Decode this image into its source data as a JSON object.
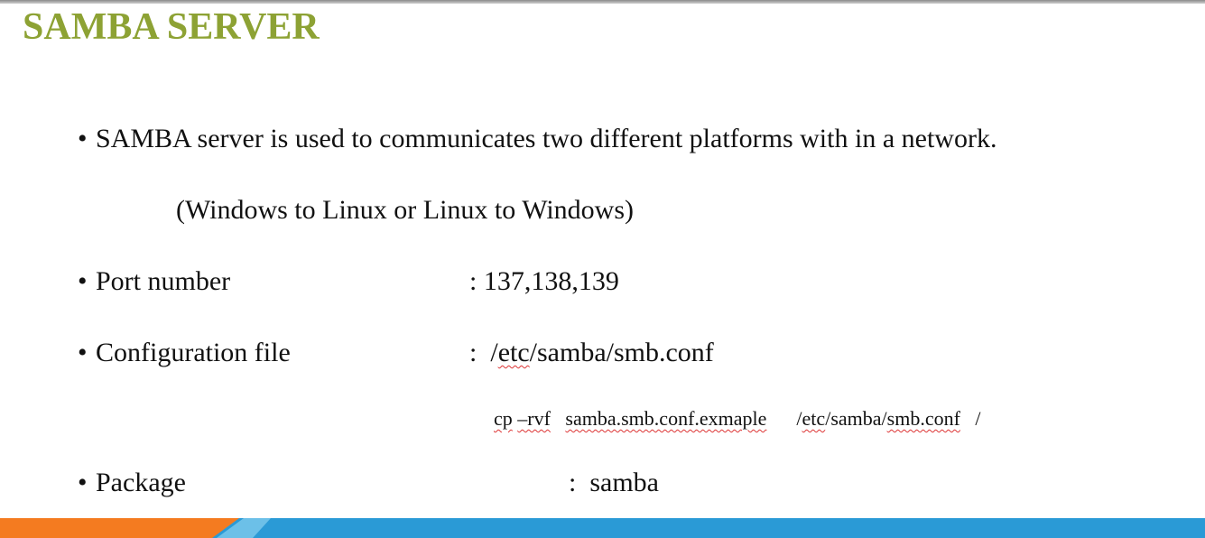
{
  "slide": {
    "title": "SAMBA SERVER",
    "bullet_glyph": "•",
    "intro": {
      "text": "SAMBA server is used to communicates two different platforms with in a network.",
      "note": "(Windows to Linux  or  Linux to Windows)"
    },
    "port": {
      "label": "Port number",
      "value": ": 137,138,139"
    },
    "config": {
      "label": "Configuration file",
      "separator": ":",
      "path_prefix": "/",
      "path_underlined": "etc",
      "path_suffix": "/samba/smb.conf",
      "command": {
        "cmd": "cp",
        "flag": "–rvf",
        "source": "samba.smb.conf.exmaple",
        "dest_prefix": "/",
        "dest_dir": "etc",
        "dest_mid": "/samba/",
        "dest_file": "smb.conf",
        "trailing": "/"
      }
    },
    "package": {
      "label": "Package",
      "separator": ":",
      "value": "samba"
    }
  },
  "colors": {
    "title": "#8da234",
    "band_blue": "#2a9ad6",
    "band_orange": "#f47b20",
    "spellcheck": "#d33"
  }
}
